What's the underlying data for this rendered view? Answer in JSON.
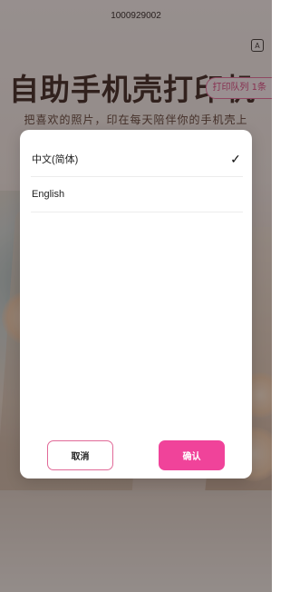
{
  "header": {
    "device_id": "1000929002",
    "language_icon": "translate-icon",
    "language_icon_glyph": "A"
  },
  "hero": {
    "title": "自助手机壳打印机",
    "subtitle": "把喜欢的照片，印在每天陪伴你的手机壳上"
  },
  "queue_badge": {
    "label": "打印队列 1条"
  },
  "language_dialog": {
    "options": [
      {
        "label": "中文(简体)",
        "selected": true
      },
      {
        "label": "English",
        "selected": false
      }
    ],
    "check_glyph": "✓",
    "cancel_label": "取消",
    "confirm_label": "确认"
  },
  "colors": {
    "accent": "#f0439a",
    "accent_border": "#e16a98",
    "title": "#3a241c"
  }
}
